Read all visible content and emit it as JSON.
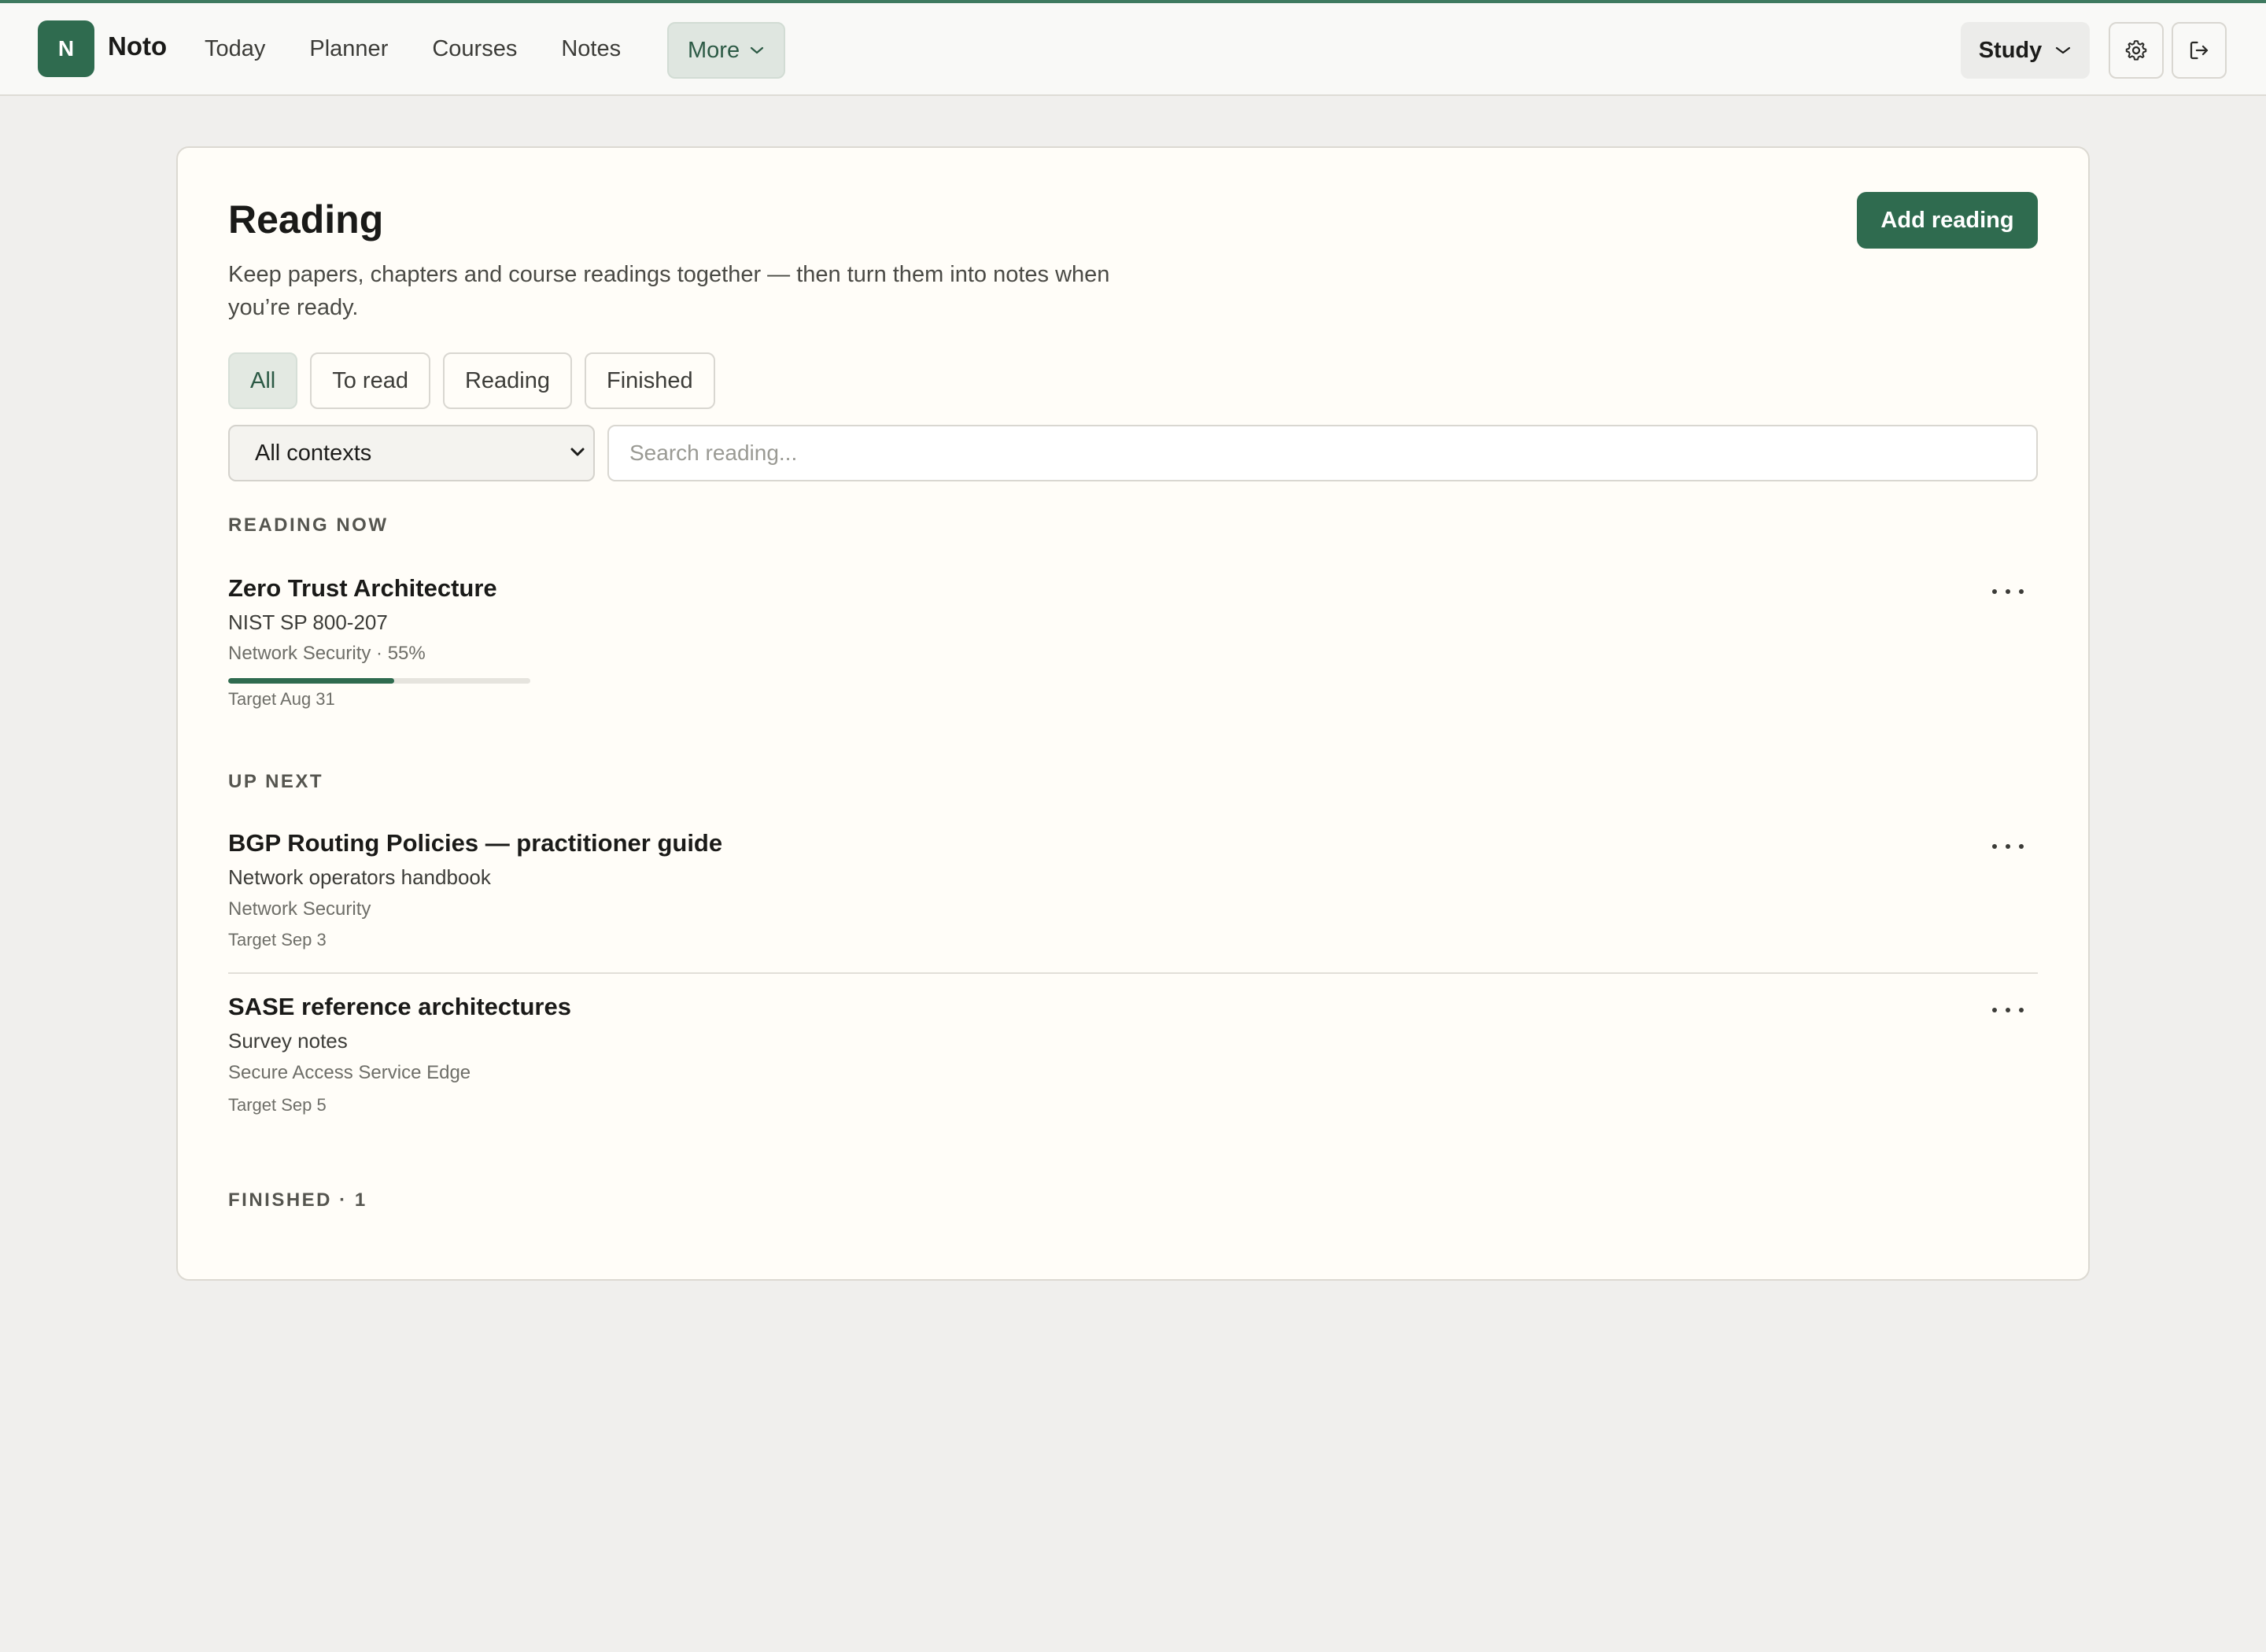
{
  "app": {
    "logo_letter": "N",
    "name": "Noto"
  },
  "nav": {
    "items": [
      {
        "label": "Today"
      },
      {
        "label": "Planner"
      },
      {
        "label": "Courses"
      },
      {
        "label": "Notes"
      }
    ],
    "more_label": "More"
  },
  "header_right": {
    "mode_label": "Study",
    "settings_icon": "gear-icon",
    "logout_icon": "logout-icon"
  },
  "page": {
    "title": "Reading",
    "subtitle": "Keep papers, chapters and course readings together — then turn them into notes when you’re ready.",
    "add_button": "Add reading"
  },
  "filters": [
    {
      "label": "All",
      "active": true
    },
    {
      "label": "To read",
      "active": false
    },
    {
      "label": "Reading",
      "active": false
    },
    {
      "label": "Finished",
      "active": false
    }
  ],
  "context_select": {
    "value": "All contexts"
  },
  "search": {
    "placeholder": "Search reading..."
  },
  "sections": {
    "reading_now": {
      "heading": "READING NOW",
      "items": [
        {
          "title": "Zero Trust Architecture",
          "source": "NIST SP 800-207",
          "meta": "Network Security · 55%",
          "progress": 0.55,
          "target": "Target Aug 31"
        }
      ]
    },
    "up_next": {
      "heading": "UP NEXT",
      "items": [
        {
          "title": "BGP Routing Policies — practitioner guide",
          "source": "Network operators handbook",
          "meta": "Network Security",
          "target": "Target Sep 3"
        },
        {
          "title": "SASE reference architectures",
          "source": "Survey notes",
          "meta": "Secure Access Service Edge",
          "target": "Target Sep 5"
        }
      ]
    },
    "finished": {
      "heading": "FINISHED · 1"
    }
  },
  "colors": {
    "accent": "#2f6b4f",
    "page_background": "#f0efed",
    "card_background": "#fffdf8"
  }
}
